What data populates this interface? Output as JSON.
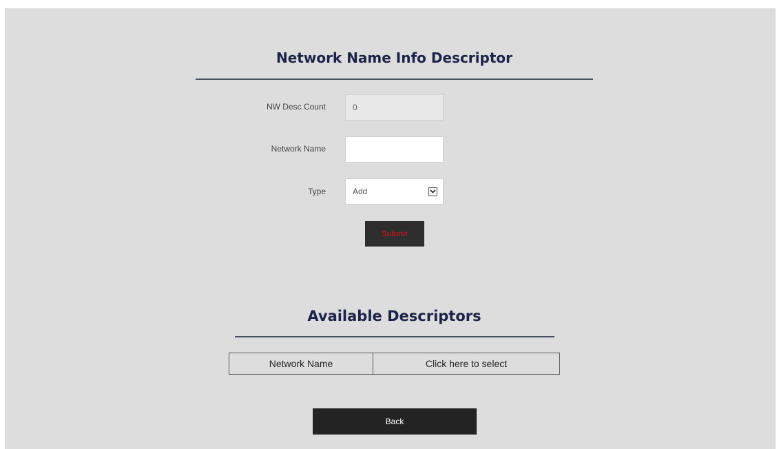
{
  "form": {
    "title": "Network Name Info Descriptor",
    "count_label": "NW Desc Count",
    "count_value": "0",
    "name_label": "Network Name",
    "name_value": "",
    "type_label": "Type",
    "type_selected": "Add",
    "type_icon": "chevron-down-icon",
    "submit_label": "Submit",
    "submit_text_color": "#b21a1a"
  },
  "descriptors": {
    "title": "Available Descriptors",
    "rows": [
      {
        "name": "Network Name",
        "action": "Click here to select"
      }
    ]
  },
  "footer": {
    "back_label": "Back"
  },
  "colors": {
    "heading": "#1b2448",
    "panel_bg": "#dddddd",
    "button_bg": "#232323"
  }
}
